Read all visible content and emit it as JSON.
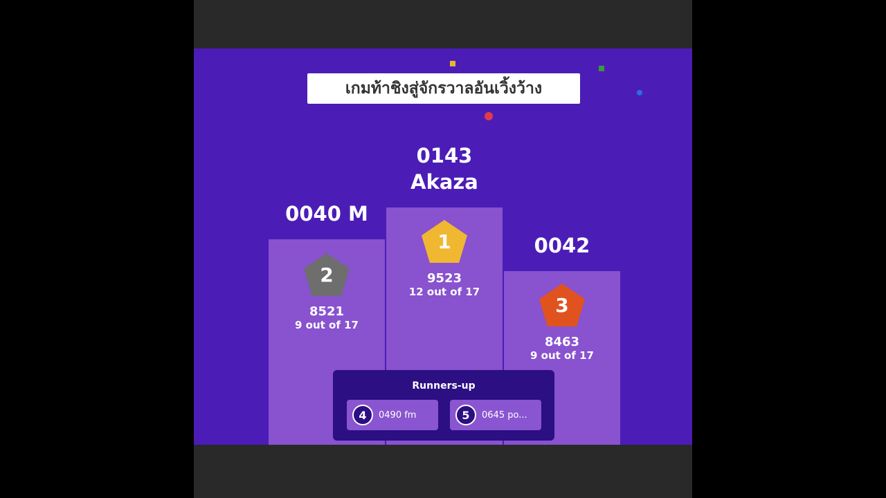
{
  "title": "เกมท้าชิงสู่จักรวาลอันเวิ้งว้าง",
  "podium": [
    {
      "rank": "1",
      "name_line1": "0143",
      "name_line2": "Akaza",
      "score": "9523",
      "correct": "12 out of 17",
      "color": "#f0b731"
    },
    {
      "rank": "2",
      "name_line1": "0040 M",
      "score": "8521",
      "correct": "9 out of 17",
      "color": "#6e6e6e"
    },
    {
      "rank": "3",
      "name_line1": "0042",
      "score": "8463",
      "correct": "9 out of 17",
      "color": "#e0531f"
    }
  ],
  "runners_up": {
    "title": "Runners-up",
    "items": [
      {
        "rank": "4",
        "name": "0490 fm"
      },
      {
        "rank": "5",
        "name": "0645 po..."
      }
    ]
  }
}
